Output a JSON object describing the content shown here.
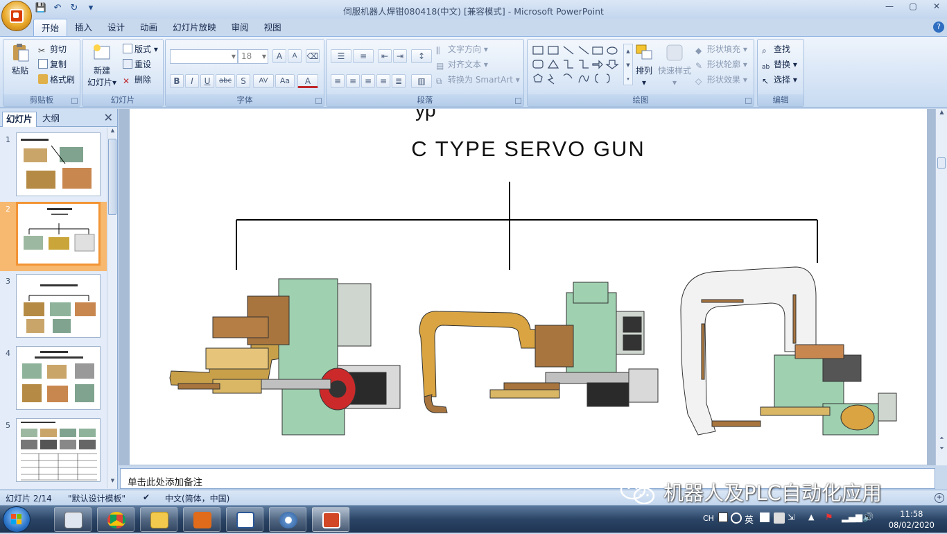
{
  "window": {
    "title": "伺服机器人焊钳080418(中文) [兼容模式] - Microsoft PowerPoint"
  },
  "qat": {
    "save": "💾",
    "undo": "↶",
    "redo": "↻",
    "more": "▾"
  },
  "tabs": [
    "开始",
    "插入",
    "设计",
    "动画",
    "幻灯片放映",
    "审阅",
    "视图"
  ],
  "ribbon": {
    "clipboard": {
      "label": "剪贴板",
      "paste": "粘贴",
      "cut": "剪切",
      "copy": "复制",
      "format_painter": "格式刷"
    },
    "slides": {
      "label": "幻灯片",
      "new_slide": "新建",
      "new_slide_2": "幻灯片",
      "layout": "版式",
      "reset": "重设",
      "delete": "删除"
    },
    "font": {
      "label": "字体",
      "font_size": "18",
      "bold": "B",
      "italic": "I",
      "underline": "U",
      "strike": "abc",
      "shadow": "S",
      "spacing": "AV",
      "case": "Aa",
      "color": "A",
      "grow": "A",
      "shrink": "A"
    },
    "paragraph": {
      "label": "段落",
      "text_direction": "文字方向",
      "align_text": "对齐文本",
      "smartart": "转换为 SmartArt"
    },
    "drawing": {
      "label": "绘图",
      "arrange": "排列",
      "quick_styles": "快速样式",
      "shape_fill": "形状填充",
      "shape_outline": "形状轮廓",
      "shape_effects": "形状效果"
    },
    "editing": {
      "label": "编辑",
      "find": "查找",
      "replace": "替换",
      "select": "选择"
    }
  },
  "slide_pane": {
    "tabs": [
      "幻灯片",
      "大纲"
    ],
    "thumbs": [
      "1",
      "2",
      "3",
      "4",
      "5"
    ],
    "selected": 2
  },
  "slide": {
    "title": "C TYPE SERVO GUN",
    "top_glyph": "yp"
  },
  "notes": {
    "placeholder": "单击此处添加备注"
  },
  "status": {
    "slide_count": "幻灯片 2/14",
    "theme": "\"默认设计模板\"",
    "language": "中文(简体，中国)"
  },
  "watermark": {
    "text": "机器人及PLC自动化应用"
  },
  "taskbar": {
    "tray": {
      "lang": "CH",
      "ime": "英"
    },
    "clock": {
      "time": "11:58",
      "date": "08/02/2020"
    }
  },
  "colors": {
    "accent": "#f29536",
    "ribbon": "#d3e2f5",
    "taskbar": "#2b4566"
  }
}
